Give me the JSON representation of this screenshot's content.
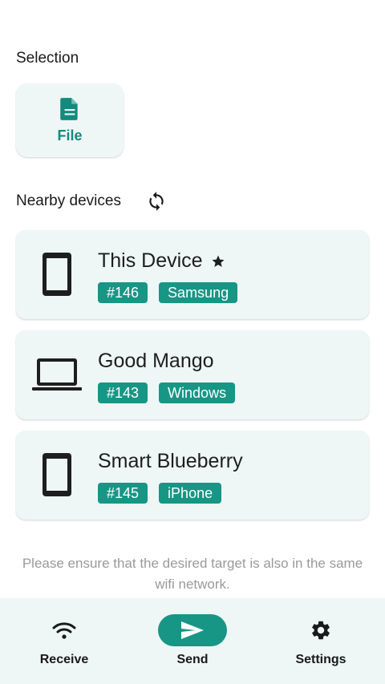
{
  "selection": {
    "title": "Selection",
    "file_label": "File"
  },
  "nearby": {
    "title": "Nearby devices"
  },
  "devices": [
    {
      "name": "This Device",
      "id_badge": "#146",
      "type_badge": "Samsung",
      "icon": "smartphone-icon",
      "favorite": true
    },
    {
      "name": "Good Mango",
      "id_badge": "#143",
      "type_badge": "Windows",
      "icon": "laptop-icon",
      "favorite": false
    },
    {
      "name": "Smart Blueberry",
      "id_badge": "#145",
      "type_badge": "iPhone",
      "icon": "smartphone-icon",
      "favorite": false
    }
  ],
  "hint": "Please ensure that the desired target is also in the same wifi network.",
  "nav": {
    "receive": "Receive",
    "send": "Send",
    "settings": "Settings",
    "active": "send"
  },
  "colors": {
    "accent": "#179685",
    "card_bg": "#eef7f6",
    "hint_text": "#9a9a9a"
  }
}
